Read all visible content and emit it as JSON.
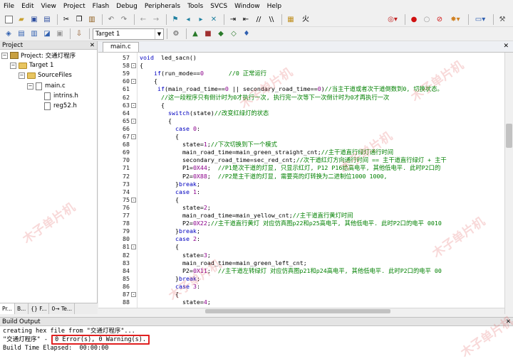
{
  "menu": [
    "File",
    "Edit",
    "View",
    "Project",
    "Flash",
    "Debug",
    "Peripherals",
    "Tools",
    "SVCS",
    "Window",
    "Help"
  ],
  "toolbar": {
    "find_text": "火",
    "target": "Target 1"
  },
  "project": {
    "title": "Project",
    "root": "Project: 交通灯程序",
    "target": "Target 1",
    "group": "SourceFiles",
    "file": "main.c",
    "includes": [
      "intrins.h",
      "reg52.h"
    ],
    "tabs": [
      "Pr...",
      "B...",
      "{} F...",
      "0→ Te..."
    ]
  },
  "editor": {
    "tab": "main.c",
    "lines": [
      {
        "n": "57",
        "fold": "",
        "segs": [
          [
            "kw",
            "void"
          ],
          [
            "",
            "  led_sacn()"
          ]
        ]
      },
      {
        "n": "58",
        "fold": "-",
        "segs": [
          [
            "",
            "{"
          ]
        ]
      },
      {
        "n": "59",
        "fold": "",
        "segs": [
          [
            "",
            "    "
          ],
          [
            "kw",
            "if"
          ],
          [
            "",
            "(run_mode=="
          ],
          [
            "nm",
            "0"
          ],
          [
            "",
            "       "
          ],
          [
            "cm",
            "//0 正常运行"
          ]
        ]
      },
      {
        "n": "60",
        "fold": "-",
        "segs": [
          [
            "",
            "    {"
          ]
        ]
      },
      {
        "n": "61",
        "fold": "",
        "segs": [
          [
            "",
            "     "
          ],
          [
            "kw",
            "if"
          ],
          [
            "",
            "(main_road_time=="
          ],
          [
            "nm",
            "0"
          ],
          [
            "",
            " || secondary_road_time=="
          ],
          [
            "nm",
            "0"
          ],
          [
            "",
            ")"
          ],
          [
            "cm",
            "//当主干道或者次干道倒数到0, 切换状态。"
          ]
        ]
      },
      {
        "n": "62",
        "fold": "",
        "segs": [
          [
            "",
            "      "
          ],
          [
            "cm",
            "//这一段程序只有倒计时为0才执行一次, 执行完一次等下一次倒计时为0才再执行一次"
          ]
        ]
      },
      {
        "n": "63",
        "fold": "-",
        "segs": [
          [
            "",
            "      {"
          ]
        ]
      },
      {
        "n": "64",
        "fold": "",
        "segs": [
          [
            "",
            "        "
          ],
          [
            "kw",
            "switch"
          ],
          [
            "",
            "(state)"
          ],
          [
            "cm",
            "//改变红绿灯的状态"
          ]
        ]
      },
      {
        "n": "65",
        "fold": "-",
        "segs": [
          [
            "",
            "        {"
          ]
        ]
      },
      {
        "n": "66",
        "fold": "",
        "segs": [
          [
            "",
            "          "
          ],
          [
            "kw",
            "case"
          ],
          [
            "",
            " "
          ],
          [
            "nm",
            "0"
          ],
          [
            "",
            ":"
          ]
        ]
      },
      {
        "n": "67",
        "fold": "-",
        "segs": [
          [
            "",
            "          {"
          ]
        ]
      },
      {
        "n": "68",
        "fold": "",
        "segs": [
          [
            "",
            "            state="
          ],
          [
            "nm",
            "1"
          ],
          [
            "",
            ";"
          ],
          [
            "cm",
            "//下次切换到下一个模式"
          ]
        ]
      },
      {
        "n": "69",
        "fold": "",
        "segs": [
          [
            "",
            "            main_road_time=main_green_straight_cnt;"
          ],
          [
            "cm",
            "//主干道直行绿灯通行时间"
          ]
        ]
      },
      {
        "n": "70",
        "fold": "",
        "segs": [
          [
            "",
            "            secondary_road_time=sec_red_cnt;"
          ],
          [
            "cm",
            "//次干道红灯方向通行时间 == 主干道直行绿灯 + 主干"
          ]
        ]
      },
      {
        "n": "71",
        "fold": "",
        "segs": [
          [
            "",
            "            P1="
          ],
          [
            "nm",
            "0X44"
          ],
          [
            "",
            ";  "
          ],
          [
            "cm",
            "//P1是次干道的灯显, 只显示红灯, P12 P16给高电平, 其他低电平. 此时P2口的"
          ]
        ]
      },
      {
        "n": "72",
        "fold": "",
        "segs": [
          [
            "",
            "            P2="
          ],
          [
            "nm",
            "0X88"
          ],
          [
            "",
            ";  "
          ],
          [
            "cm",
            "//P2是主干道的灯显, 需要亮的灯转换为二进制位1000 1000,"
          ]
        ]
      },
      {
        "n": "73",
        "fold": "",
        "segs": [
          [
            "",
            "          }"
          ],
          [
            "kw",
            "break"
          ],
          [
            "",
            ";"
          ]
        ]
      },
      {
        "n": "74",
        "fold": "",
        "segs": [
          [
            "",
            "          "
          ],
          [
            "kw",
            "case"
          ],
          [
            "",
            " "
          ],
          [
            "nm",
            "1"
          ],
          [
            "",
            ":"
          ]
        ]
      },
      {
        "n": "75",
        "fold": "-",
        "segs": [
          [
            "",
            "          {"
          ]
        ]
      },
      {
        "n": "76",
        "fold": "",
        "segs": [
          [
            "",
            "            state="
          ],
          [
            "nm",
            "2"
          ],
          [
            "",
            ";"
          ]
        ]
      },
      {
        "n": "77",
        "fold": "",
        "segs": [
          [
            "",
            "            main_road_time=main_yellow_cnt;"
          ],
          [
            "cm",
            "//主干道直行黄灯时间"
          ]
        ]
      },
      {
        "n": "78",
        "fold": "",
        "segs": [
          [
            "",
            "            P2="
          ],
          [
            "nm",
            "0X22"
          ],
          [
            "",
            ";"
          ],
          [
            "cm",
            "//主干道直行黄灯 对应仿真图p22和p25高电平, 其他低电平. 此时P2口的电平 0010"
          ]
        ]
      },
      {
        "n": "79",
        "fold": "",
        "segs": [
          [
            "",
            "          }"
          ],
          [
            "kw",
            "break"
          ],
          [
            "",
            ";"
          ]
        ]
      },
      {
        "n": "80",
        "fold": "",
        "segs": [
          [
            "",
            "          "
          ],
          [
            "kw",
            "case"
          ],
          [
            "",
            " "
          ],
          [
            "nm",
            "2"
          ],
          [
            "",
            ":"
          ]
        ]
      },
      {
        "n": "81",
        "fold": "-",
        "segs": [
          [
            "",
            "          {"
          ]
        ]
      },
      {
        "n": "82",
        "fold": "",
        "segs": [
          [
            "",
            "            state="
          ],
          [
            "nm",
            "3"
          ],
          [
            "",
            ";"
          ]
        ]
      },
      {
        "n": "83",
        "fold": "",
        "segs": [
          [
            "",
            "            main_road_time=main_green_left_cnt;"
          ]
        ]
      },
      {
        "n": "84",
        "fold": "",
        "segs": [
          [
            "",
            "            P2="
          ],
          [
            "nm",
            "0X11"
          ],
          [
            "",
            ";  "
          ],
          [
            "cm",
            "//主干道左转绿灯 对应仿真图p21和p24高电平, 其他低电平. 此时P2口的电平 00"
          ]
        ]
      },
      {
        "n": "85",
        "fold": "",
        "segs": [
          [
            "",
            "          }"
          ],
          [
            "kw",
            "break"
          ],
          [
            "",
            ";"
          ]
        ]
      },
      {
        "n": "86",
        "fold": "",
        "segs": [
          [
            "",
            "          "
          ],
          [
            "kw",
            "case"
          ],
          [
            "",
            " "
          ],
          [
            "nm",
            "3"
          ],
          [
            "",
            ":"
          ]
        ]
      },
      {
        "n": "87",
        "fold": "-",
        "segs": [
          [
            "",
            "          {"
          ]
        ]
      },
      {
        "n": "88",
        "fold": "",
        "segs": [
          [
            "",
            "            state="
          ],
          [
            "nm",
            "4"
          ],
          [
            "",
            ";"
          ]
        ]
      }
    ]
  },
  "build": {
    "title": "Build Output",
    "line1": "creating hex file from \"交通灯程序\"...",
    "line2_prefix": "\"交通灯程序\" - ",
    "line2_result": "0 Error(s), 0 Warning(s).",
    "line3": "Build Time Elapsed:  00:00:00"
  },
  "watermark": "木子单片机",
  "colors": {
    "keyword": "#0000c0",
    "comment": "#008000",
    "number": "#8b008b",
    "error_box": "#e02020"
  }
}
